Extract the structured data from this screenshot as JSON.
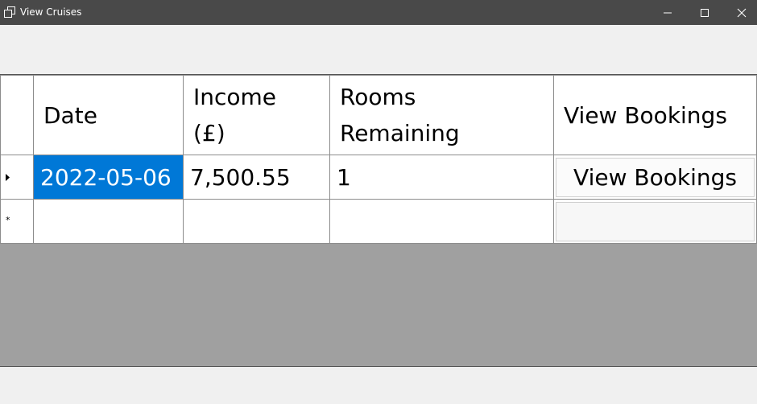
{
  "window": {
    "title": "View Cruises",
    "icon": "app-window-icon",
    "controls": [
      "minimize-icon",
      "maximize-icon",
      "close-icon"
    ]
  },
  "grid": {
    "columns": [
      {
        "line1": "Date",
        "line2": ""
      },
      {
        "line1": "Income",
        "line2": "(£)"
      },
      {
        "line1": "Rooms",
        "line2": "Remaining"
      },
      {
        "line1": "View Bookings",
        "line2": ""
      }
    ],
    "rows": [
      {
        "indicator": "current-row-arrow-icon",
        "date": "2022-05-06",
        "income": "7,500.55",
        "rooms": "1",
        "button": "View Bookings"
      }
    ],
    "new_row": {
      "indicator": "*"
    }
  },
  "colors": {
    "titlebar": "#494949",
    "selection": "#0078d7",
    "grid_background": "#a0a0a0"
  }
}
